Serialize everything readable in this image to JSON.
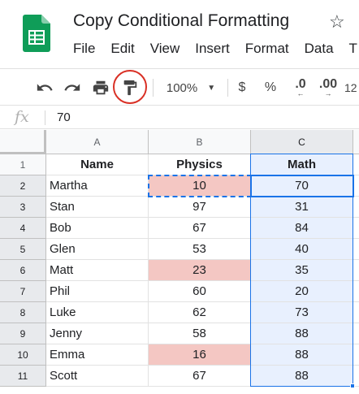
{
  "app": {
    "title": "Copy Conditional Formatting",
    "logo_icon": "google-sheets-icon",
    "brand_color": "#0f9d58",
    "menu": [
      "File",
      "Edit",
      "View",
      "Insert",
      "Format",
      "Data",
      "T"
    ]
  },
  "toolbar": {
    "undo_icon": "undo-icon",
    "redo_icon": "redo-icon",
    "print_icon": "print-icon",
    "paint_format_icon": "paint-format-icon",
    "highlight_color": "#d93025",
    "zoom": "100%",
    "currency": "$",
    "percent": "%",
    "decrease_decimal": ".0",
    "increase_decimal": ".00",
    "more_formats": "12"
  },
  "formula_bar": {
    "fx_label": "fx",
    "value": "70"
  },
  "sheet": {
    "column_headers": [
      "A",
      "B",
      "C"
    ],
    "row_headers": [
      "1",
      "2",
      "3",
      "4",
      "5",
      "6",
      "7",
      "8",
      "9",
      "10",
      "11"
    ],
    "header_row": [
      "Name",
      "Physics",
      "Math"
    ],
    "rows": [
      {
        "name": "Martha",
        "physics": "10",
        "math": "70",
        "physics_low": true
      },
      {
        "name": "Stan",
        "physics": "97",
        "math": "31",
        "physics_low": false
      },
      {
        "name": "Bob",
        "physics": "67",
        "math": "84",
        "physics_low": false
      },
      {
        "name": "Glen",
        "physics": "53",
        "math": "40",
        "physics_low": false
      },
      {
        "name": "Matt",
        "physics": "23",
        "math": "35",
        "physics_low": true
      },
      {
        "name": "Phil",
        "physics": "60",
        "math": "20",
        "physics_low": false
      },
      {
        "name": "Luke",
        "physics": "62",
        "math": "73",
        "physics_low": false
      },
      {
        "name": "Jenny",
        "physics": "58",
        "math": "88",
        "physics_low": false
      },
      {
        "name": "Emma",
        "physics": "16",
        "math": "88",
        "physics_low": true
      },
      {
        "name": "Scott",
        "physics": "67",
        "math": "88",
        "physics_low": false
      }
    ],
    "highlight_fill": "#f4c7c3",
    "selection_color": "#1a73e8",
    "selection_fill": "#e8f0fe"
  }
}
